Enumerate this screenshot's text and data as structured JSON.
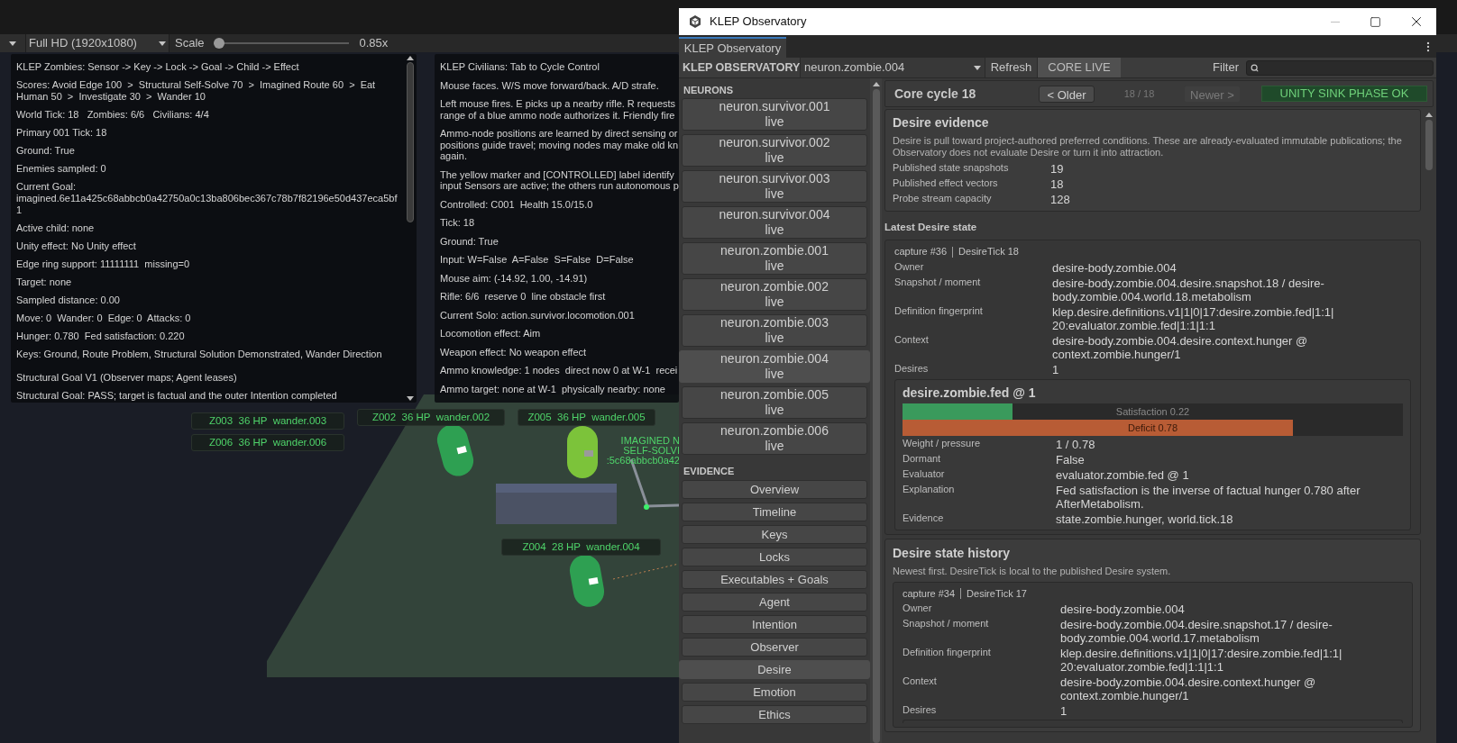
{
  "game_toolbar": {
    "resolution": "Full HD (1920x1080)",
    "scale_label": "Scale",
    "scale": {
      "level": 0
    },
    "scale_reading": "0.85x"
  },
  "zombie_hud": {
    "lines": [
      "KLEP Zombies: Sensor -> Key -> Lock -> Goal -> Child -> Effect",
      "Scores: Avoid Edge 100  >  Structural Self-Solve 70  >  Imagined Route 60  >  Eat Human 50  >  Investigate 30  >  Wander 10",
      "World Tick: 18   Zombies: 6/6   Civilians: 4/4",
      "Primary 001 Tick: 18",
      "Ground: True",
      "Enemies sampled: 0",
      "Current Goal: imagined.6e11a425c68abbcb0a42750a0c13ba806bec367c78b7f82196e50d437eca5bf1",
      "Active child: none",
      "Unity effect: No Unity effect",
      "Edge ring support: 11111111  missing=0",
      "Target: none",
      "Sampled distance: 0.00",
      "Move: 0  Wander: 0  Edge: 0  Attacks: 0",
      "Hunger: 0.780  Fed satisfaction: 0.220",
      "Keys: Ground, Route Problem, Structural Solution Demonstrated, Wander Direction",
      "Structural Goal V1 (Observer maps; Agent leases)",
      "Structural Goal: PASS; target is factual and the outer Intention completed"
    ]
  },
  "civilian_hud": {
    "paragraphs": [
      {
        "lines": [
          "KLEP Civilians: Tab to Cycle Control"
        ]
      },
      {
        "lines": [
          "Mouse faces. W/S move forward/back. A/D strafe."
        ]
      },
      {
        "lines": [
          "Left mouse fires. E picks up a nearby rifle. R requests",
          "range of a blue ammo node authorizes it. Friendly fire"
        ]
      },
      {
        "lines": [
          "Ammo-node positions are learned by direct sensing or",
          "positions guide travel; moving nodes may make old kn",
          "again."
        ]
      },
      {
        "lines": [
          "The yellow marker and [CONTROLLED] label identify",
          "input Sensors are active; the others run autonomous p"
        ]
      },
      {
        "lines": [
          "Controlled: C001  Health 15.0/15.0"
        ]
      },
      {
        "lines": [
          "Tick: 18"
        ]
      },
      {
        "lines": [
          "Ground: True"
        ]
      },
      {
        "lines": [
          "Input: W=False  A=False  S=False  D=False"
        ]
      },
      {
        "lines": [
          "Mouse aim: (-14.92, 1.00, -14.91)"
        ]
      },
      {
        "lines": [
          "Rifle: 6/6  reserve 0  line obstacle first"
        ]
      },
      {
        "lines": [
          "Current Solo: action.survivor.locomotion.001"
        ]
      },
      {
        "lines": [
          "Locomotion effect: Aim"
        ]
      },
      {
        "lines": [
          "Weapon effect: No weapon effect"
        ]
      },
      {
        "lines": [
          "Ammo knowledge: 1 nodes  direct now 0 at W-1  recei"
        ]
      },
      {
        "lines": [
          "Ammo target: none at W-1  physically nearby: none"
        ]
      }
    ]
  },
  "scene_labels": [
    {
      "text": "Z003  36 HP  wander.003"
    },
    {
      "text": "Z006  36 HP  wander.006"
    },
    {
      "text": "Z002  36 HP  wander.002"
    },
    {
      "text": "Z005  36 HP  wander.005"
    },
    {
      "text": "Z004  28 HP  wander.004"
    }
  ],
  "imagined_marker": [
    "IMAGINED N",
    "SELF-SOLVI",
    ":5c68abbcb0a42"
  ],
  "window": {
    "title": "KLEP Observatory",
    "tab": "KLEP Observatory",
    "toolbar": {
      "title": "KLEP OBSERVATORY",
      "neuron": "neuron.zombie.004",
      "refresh": "Refresh",
      "core_live": "CORE LIVE",
      "filter_label": "Filter"
    },
    "neurons_heading": "NEURONS",
    "neurons": [
      {
        "name": "neuron.survivor.001",
        "status": "live",
        "selected": false
      },
      {
        "name": "neuron.survivor.002",
        "status": "live",
        "selected": false
      },
      {
        "name": "neuron.survivor.003",
        "status": "live",
        "selected": false
      },
      {
        "name": "neuron.survivor.004",
        "status": "live",
        "selected": false
      },
      {
        "name": "neuron.zombie.001",
        "status": "live",
        "selected": false
      },
      {
        "name": "neuron.zombie.002",
        "status": "live",
        "selected": false
      },
      {
        "name": "neuron.zombie.003",
        "status": "live",
        "selected": false
      },
      {
        "name": "neuron.zombie.004",
        "status": "live",
        "selected": true
      },
      {
        "name": "neuron.zombie.005",
        "status": "live",
        "selected": false
      },
      {
        "name": "neuron.zombie.006",
        "status": "live",
        "selected": false
      }
    ],
    "evidence_heading": "EVIDENCE",
    "evidence": [
      {
        "label": "Overview",
        "selected": false
      },
      {
        "label": "Timeline",
        "selected": false
      },
      {
        "label": "Keys",
        "selected": false
      },
      {
        "label": "Locks",
        "selected": false
      },
      {
        "label": "Executables + Goals",
        "selected": false
      },
      {
        "label": "Agent",
        "selected": false
      },
      {
        "label": "Intention",
        "selected": false
      },
      {
        "label": "Observer",
        "selected": false
      },
      {
        "label": "Desire",
        "selected": true
      },
      {
        "label": "Emotion",
        "selected": false
      },
      {
        "label": "Ethics",
        "selected": false
      }
    ],
    "cycle": {
      "title": "Core cycle 18",
      "older": {
        "label": "< Older",
        "disabled": false
      },
      "position": "18 / 18",
      "newer": {
        "label": "Newer >",
        "disabled": true
      },
      "sink_status": "UNITY SINK PHASE OK"
    },
    "desire_evidence": {
      "title": "Desire evidence",
      "description": "Desire is pull toward project-authored preferred conditions. These are already-evaluated immutable publications; the Observatory does not evaluate Desire or turn it into attraction.",
      "fields": [
        {
          "label": "Published state snapshots",
          "value": "19"
        },
        {
          "label": "Published effect vectors",
          "value": "18"
        },
        {
          "label": "Probe stream capacity",
          "value": "128"
        }
      ]
    },
    "latest_heading": "Latest Desire state",
    "latest": {
      "capture": "capture #36",
      "tick": "DesireTick 18",
      "fields": [
        {
          "label": "Owner",
          "value": "desire-body.zombie.004"
        },
        {
          "label": "Snapshot / moment",
          "value": "desire-body.zombie.004.desire.snapshot.18 / desire-body.zombie.004.world.18.metabolism"
        },
        {
          "label": "Definition fingerprint",
          "value": "klep.desire.definitions.v1|1|0|17:desire.zombie.fed|1:1|20:evaluator.zombie.fed|1:1|1:1"
        },
        {
          "label": "Context",
          "value": "desire-body.zombie.004.desire.context.hunger @ context.zombie.hunger/1"
        },
        {
          "label": "Desires",
          "value": "1"
        }
      ],
      "desire": {
        "title": "desire.zombie.fed @ 1",
        "bars": [
          {
            "kind": "satisfaction",
            "label": "Satisfaction 0.22",
            "level": 0.22
          },
          {
            "kind": "deficit",
            "label": "Deficit 0.78",
            "level": 0.78
          }
        ],
        "fields": [
          {
            "label": "Weight / pressure",
            "value": "1 / 0.78"
          },
          {
            "label": "Dormant",
            "value": "False"
          },
          {
            "label": "Evaluator",
            "value": "evaluator.zombie.fed @ 1"
          },
          {
            "label": "Explanation",
            "value": "Fed satisfaction is the inverse of factual hunger 0.780 after AfterMetabolism."
          },
          {
            "label": "Evidence",
            "value": "state.zombie.hunger, world.tick.18"
          }
        ]
      }
    },
    "history": {
      "title": "Desire state history",
      "description": "Newest first. DesireTick is local to the published Desire system.",
      "captures": [
        {
          "capture": "capture #34",
          "tick": "DesireTick 17",
          "fields": [
            {
              "label": "Owner",
              "value": "desire-body.zombie.004"
            },
            {
              "label": "Snapshot / moment",
              "value": "desire-body.zombie.004.desire.snapshot.17 / desire-body.zombie.004.world.17.metabolism"
            },
            {
              "label": "Definition fingerprint",
              "value": "klep.desire.definitions.v1|1|0|17:desire.zombie.fed|1:1|20:evaluator.zombie.fed|1:1|1:1"
            },
            {
              "label": "Context",
              "value": "desire-body.zombie.004.desire.context.hunger @ context.zombie.hunger/1"
            },
            {
              "label": "Desires",
              "value": "1"
            }
          ]
        }
      ]
    }
  }
}
